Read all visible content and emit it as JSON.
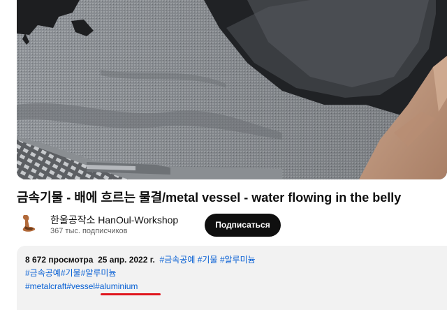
{
  "video": {
    "title": "금속기물 - 배에 흐르는 물결/metal vessel - water flowing in the belly"
  },
  "channel": {
    "name": "한울공작소 HanOul-Workshop",
    "subscribers": "367 тыс. подписчиков",
    "subscribe_label": "Подписаться"
  },
  "description": {
    "views": "8 672 просмотра",
    "date": "25 апр. 2022 г.",
    "meta_tags": [
      "#금속공예",
      "#기물",
      "#알루미늄"
    ],
    "tags_line2": [
      "#금속공예",
      "#기물",
      "#알루미늄"
    ],
    "tags_line3": [
      "#metalcraft",
      "#vessel",
      "#aluminium"
    ]
  },
  "colors": {
    "link": "#065fd4",
    "subscribe_bg": "#0f0f0f",
    "highlight_mark": "#e0161e",
    "description_bg": "#f2f2f2"
  }
}
